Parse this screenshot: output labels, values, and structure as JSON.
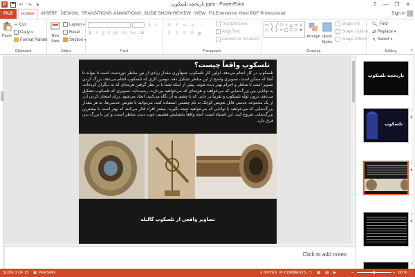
{
  "window": {
    "title": "تاریخچه تلسکوپ.pptx - PowerPoint",
    "help": "?",
    "minimize": "—",
    "restore": "❐",
    "close": "✕"
  },
  "quick_access": {
    "app": "P",
    "save": "💾",
    "undo": "↶",
    "redo": "↷",
    "customize": "▾"
  },
  "tabs": [
    "FILE",
    "HOME",
    "INSERT",
    "DESIGN",
    "TRANSITIONS",
    "ANIMATIONS",
    "SLIDE SHOW",
    "REVIEW",
    "VIEW",
    "FILEminimizer",
    "Nitro PDF Professional"
  ],
  "active_tab": "HOME",
  "account": {
    "label": "Sign in"
  },
  "ribbon": {
    "clipboard": {
      "label": "Clipboard",
      "paste": "Paste",
      "cut": "Cut",
      "copy": "Copy",
      "format_painter": "Format Painter"
    },
    "slides": {
      "label": "Slides",
      "new_slide": "New",
      "new_slide_2": "Slide",
      "layout": "Layout",
      "reset": "Reset",
      "section": "Section"
    },
    "font": {
      "label": "Font",
      "font_size": "",
      "font_name": ""
    },
    "paragraph": {
      "label": "Paragraph",
      "text_direction": "Text Direction",
      "align_text": "Align Text",
      "convert_smartart": "Convert to SmartArt"
    },
    "drawing": {
      "label": "Drawing",
      "arrange": "Arrange",
      "quick_styles": "Quick",
      "quick_styles_2": "Styles",
      "shape_fill": "Shape Fill",
      "shape_outline": "Shape Outline",
      "shape_effects": "Shape Effects"
    },
    "editing": {
      "label": "Editing",
      "find": "Find",
      "replace": "Replace",
      "select": "Select"
    }
  },
  "slide": {
    "title": "تلسکوپ واقعاً چیست؟",
    "body": "تلسکوپ در کار انجام می‌دهد. اولین کار تلسکوپ جمع‌آوری مقدار زیادی از نور مناظر دوردست است تا بتواند تا آنجا که ممکن است، تصویری واضح از این مناظر تشکیل دهد. دومین کاری که تلسکوپ انجام می‌دهد، بزرگ کردن تصویر است تا مناظر و اجرام بهتر دیده شوند. پیش از اینکه شما با در نظر گرفتن هزینه‌ای که به دیگران کرده‌اند، به توانایی بین بزرگ‌نمایی که می‌خواهید و هزینه‌ای که می‌خواهید بپردازید، رسیده‌اید. تصویری که تلسکوپ تشکیل می‌دهد، درون لوله تلسکوپ و تقریباً در جایی که با چشم به آن نگاه می‌کنید، ایجاد می‌شود. برای امتحان کردن آن، از یک مجموعه عدسی قابل تعویض کوچک به نام چشمی استفاده کنید. می‌توانید با تعویض عدسی‌ها، به هر مقدار بزرگ‌نمایی که می‌خواهید با توانایی که می‌خواهید نتیجه بگیرید. بیشتر افراد فکر می‌کنند که بهتر است با بیشترین بزرگ‌نمایی شروع کنند. این اشتباه است، آنچه واقعاً بخشایش هشتیم، خوب دیدن مناظر است، و این با بزرگ بدن فرق دارد.",
    "caption": "تصاویر واقعی از تلسکوپ گالیله"
  },
  "notes": {
    "placeholder": "Click to add notes"
  },
  "thumbnails": [
    {
      "number": "1",
      "title": "تاریخچه تلسکوپ",
      "star": ""
    },
    {
      "number": "2",
      "title": "تلسکوپ",
      "star": "★"
    },
    {
      "number": "3",
      "title": "",
      "star": "★"
    },
    {
      "number": "4",
      "title": "",
      "star": "★"
    },
    {
      "number": "5",
      "title": "",
      "star": ""
    }
  ],
  "status": {
    "slide_info": "SLIDE 3 OF 15",
    "language": "PERSIAN",
    "notes": "NOTES",
    "comments": "COMMENTS",
    "zoom": "68 %"
  },
  "colors": {
    "accent": "#d24726",
    "slide_bg": "#171717",
    "selection": "#e0693b"
  }
}
